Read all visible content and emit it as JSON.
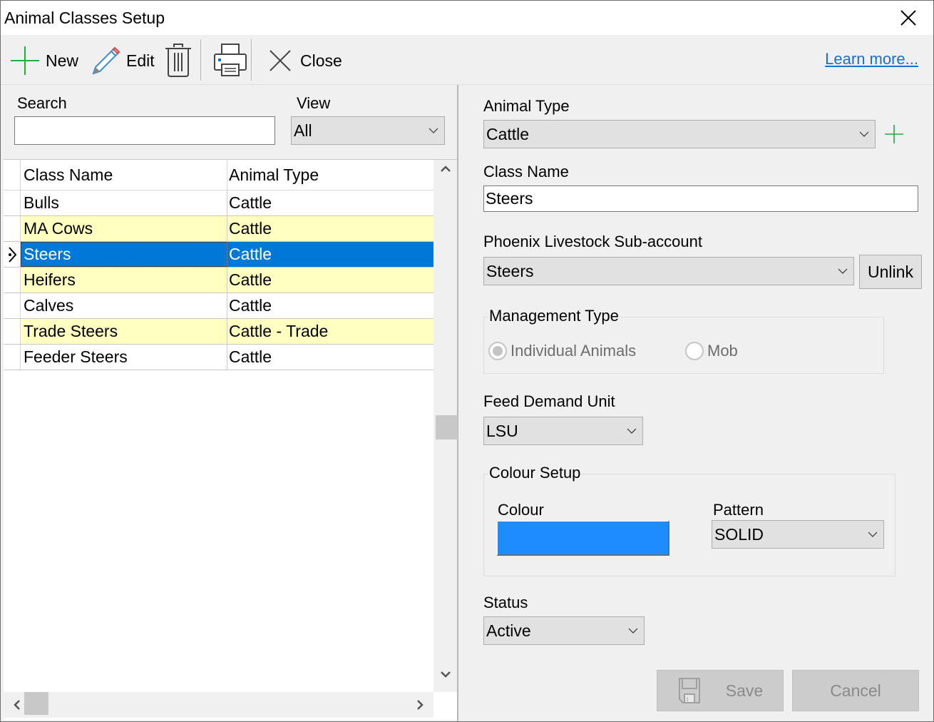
{
  "window": {
    "title": "Animal Classes Setup"
  },
  "toolbar": {
    "new_label": "New",
    "edit_label": "Edit",
    "delete_label": "",
    "print_label": "",
    "close_label": "Close",
    "learn_more_label": "Learn more..."
  },
  "left": {
    "search_label": "Search",
    "search_value": "",
    "view_label": "View",
    "view_value": "All",
    "grid": {
      "columns": [
        "Class Name",
        "Animal Type"
      ],
      "rows": [
        {
          "class_name": "Bulls",
          "animal_type": "Cattle"
        },
        {
          "class_name": "MA Cows",
          "animal_type": "Cattle"
        },
        {
          "class_name": "Steers",
          "animal_type": "Cattle"
        },
        {
          "class_name": "Heifers",
          "animal_type": "Cattle"
        },
        {
          "class_name": "Calves",
          "animal_type": "Cattle"
        },
        {
          "class_name": "Trade Steers",
          "animal_type": "Cattle - Trade"
        },
        {
          "class_name": "Feeder Steers",
          "animal_type": "Cattle"
        }
      ],
      "selected_index": 2,
      "highlighted_rows": [
        1,
        3,
        5
      ]
    }
  },
  "right": {
    "animal_type_label": "Animal Type",
    "animal_type_value": "Cattle",
    "class_name_label": "Class Name",
    "class_name_value": "Steers",
    "sub_account_label": "Phoenix Livestock Sub-account",
    "sub_account_value": "Steers",
    "unlink_label": "Unlink",
    "management_type_label": "Management Type",
    "management_options": [
      {
        "label": "Individual Animals",
        "checked": true
      },
      {
        "label": "Mob",
        "checked": false
      }
    ],
    "feed_demand_label": "Feed Demand Unit",
    "feed_demand_value": "LSU",
    "colour_setup_label": "Colour Setup",
    "colour_label": "Colour",
    "colour_value": "#1e8cff",
    "pattern_label": "Pattern",
    "pattern_value": "SOLID",
    "status_label": "Status",
    "status_value": "Active",
    "save_label": "Save",
    "cancel_label": "Cancel"
  },
  "colors": {
    "selection": "#0078d7",
    "row_highlight": "#ffffc0",
    "link": "#1a6fc9",
    "add_icon": "#22aa44"
  }
}
